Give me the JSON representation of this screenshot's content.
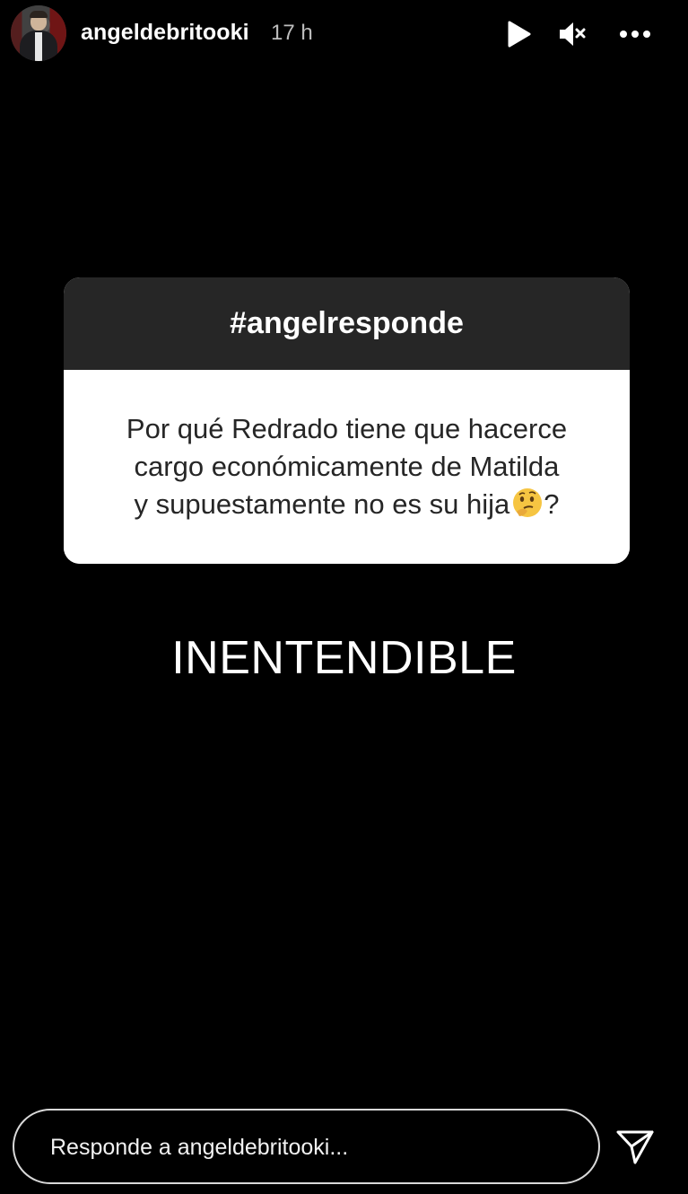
{
  "header": {
    "username": "angeldebritooki",
    "time": "17 h",
    "icons": {
      "play": "play-icon",
      "mute": "muted-speaker-icon",
      "more": "more-options-icon"
    }
  },
  "question_card": {
    "tag": "#angelresponde",
    "question_lines": [
      "Por qué Redrado tiene que hacerce",
      "cargo económicamente de Matilda",
      "y supuestamente no es su hija"
    ],
    "question_suffix": "?",
    "emoji": "thinking-face-emoji"
  },
  "answer_text": "INENTENDIBLE",
  "reply": {
    "placeholder": "Responde a angeldebritooki...",
    "value": ""
  },
  "colors": {
    "background": "#000000",
    "card_header": "#262626",
    "card_body": "#ffffff",
    "card_text": "#262626"
  }
}
